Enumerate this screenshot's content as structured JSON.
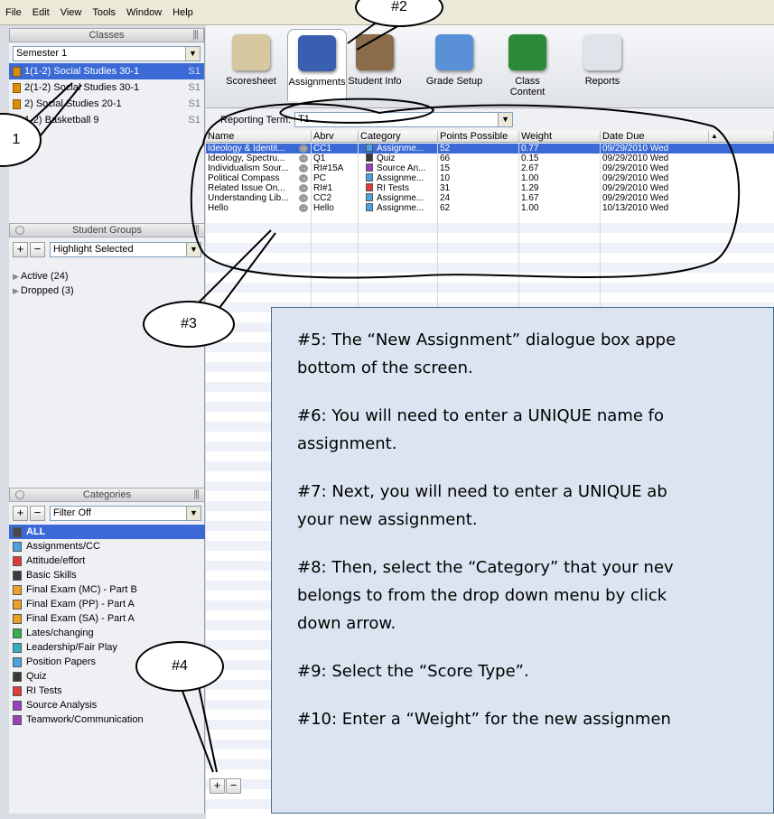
{
  "menubar": [
    "File",
    "Edit",
    "View",
    "Tools",
    "Window",
    "Help"
  ],
  "classes_panel": {
    "title": "Classes",
    "term": "Semester 1",
    "items": [
      {
        "label": "1(1-2) Social Studies 30-1",
        "term": "S1",
        "selected": true
      },
      {
        "label": "2(1-2) Social Studies 30-1",
        "term": "S1",
        "selected": false
      },
      {
        "label": "2) Social Studies 20-1",
        "term": "S1",
        "selected": false
      },
      {
        "label": "1-2) Basketball 9",
        "term": "S1",
        "selected": false
      }
    ]
  },
  "student_groups": {
    "title": "Student Groups",
    "filter": "Highlight Selected",
    "items": [
      "Active (24)",
      "Dropped (3)"
    ]
  },
  "categories_panel": {
    "title": "Categories",
    "filter": "Filter Off",
    "items": [
      {
        "label": "ALL",
        "color": "#4a4a4a",
        "selected": true
      },
      {
        "label": "Assignments/CC",
        "color": "#4aa3e0"
      },
      {
        "label": "Attitude/effort",
        "color": "#e03a3a"
      },
      {
        "label": "Basic Skills",
        "color": "#3a3a3a"
      },
      {
        "label": "Final Exam (MC) - Part B",
        "color": "#f0a020"
      },
      {
        "label": "Final Exam (PP) - Part A",
        "color": "#f0a020"
      },
      {
        "label": "Final Exam (SA) - Part A",
        "color": "#f0a020"
      },
      {
        "label": "Lates/changing",
        "color": "#2fb04a"
      },
      {
        "label": "Leadership/Fair Play",
        "color": "#2fb0c0"
      },
      {
        "label": "Position Papers",
        "color": "#4aa3e0"
      },
      {
        "label": "Quiz",
        "color": "#3a3a3a"
      },
      {
        "label": "RI Tests",
        "color": "#e03a3a"
      },
      {
        "label": "Source Analysis",
        "color": "#9a40c0"
      },
      {
        "label": "Teamwork/Communication",
        "color": "#9a40c0"
      }
    ]
  },
  "tabs": [
    {
      "label": "Scoresheet",
      "icon": "scoresheet-icon",
      "color": "#d8c8a0"
    },
    {
      "label": "Assignments",
      "icon": "assignments-icon",
      "color": "#3a5fb0",
      "active": true
    },
    {
      "label": "Student Info",
      "icon": "student-info-icon",
      "color": "#8a6b4a"
    },
    {
      "label": "Grade Setup",
      "icon": "grade-setup-icon",
      "color": "#5a90d8"
    },
    {
      "label": "Class Content",
      "icon": "class-content-icon",
      "color": "#2a8a3a"
    },
    {
      "label": "Reports",
      "icon": "reports-icon",
      "color": "#e0e4ea"
    }
  ],
  "reporting_term": {
    "label": "Reporting Term:",
    "value": "T1"
  },
  "grid": {
    "headers": [
      "Name",
      "Abrv",
      "Category",
      "Points Possible",
      "Weight",
      "Date Due"
    ],
    "rows": [
      {
        "name": "Ideology & Identit...",
        "abrv": "CC1",
        "category": "Assignme...",
        "cat_color": "#4aa3e0",
        "points": "52",
        "weight": "0.77",
        "date": "09/29/2010 Wed",
        "selected": true
      },
      {
        "name": "Ideology, Spectru...",
        "abrv": "Q1",
        "category": "Quiz",
        "cat_color": "#3a3a3a",
        "points": "66",
        "weight": "0.15",
        "date": "09/29/2010 Wed"
      },
      {
        "name": "Individualism Sour...",
        "abrv": "RI#15A",
        "category": "Source An...",
        "cat_color": "#9a40c0",
        "points": "15",
        "weight": "2.67",
        "date": "09/29/2010 Wed"
      },
      {
        "name": "Political Compass",
        "abrv": "PC",
        "category": "Assignme...",
        "cat_color": "#4aa3e0",
        "points": "10",
        "weight": "1.00",
        "date": "09/29/2010 Wed"
      },
      {
        "name": "Related Issue On...",
        "abrv": "RI#1",
        "category": "RI Tests",
        "cat_color": "#e03a3a",
        "points": "31",
        "weight": "1.29",
        "date": "09/29/2010 Wed"
      },
      {
        "name": "Understanding Lib...",
        "abrv": "CC2",
        "category": "Assignme...",
        "cat_color": "#4aa3e0",
        "points": "24",
        "weight": "1.67",
        "date": "09/29/2010 Wed"
      },
      {
        "name": "Hello",
        "abrv": "Hello",
        "category": "Assignme...",
        "cat_color": "#4aa3e0",
        "points": "62",
        "weight": "1.00",
        "date": "10/13/2010 Wed"
      }
    ]
  },
  "callout": {
    "lines": [
      "#5: The “New Assignment” dialogue box appe|bottom of the screen.",
      "#6: You will need to enter a UNIQUE name fo|assignment.",
      "#7: Next, you will need to enter a UNIQUE ab|your new assignment.",
      "#8: Then, select the “Category” that your nev|belongs to from the drop down menu by click|down arrow.",
      "#9: Select the “Score Type”.",
      "#10: Enter a “Weight” for the new assignmen"
    ]
  },
  "balloons": {
    "b1": "1",
    "b2": "#2",
    "b3": "#3",
    "b4": "#4"
  }
}
